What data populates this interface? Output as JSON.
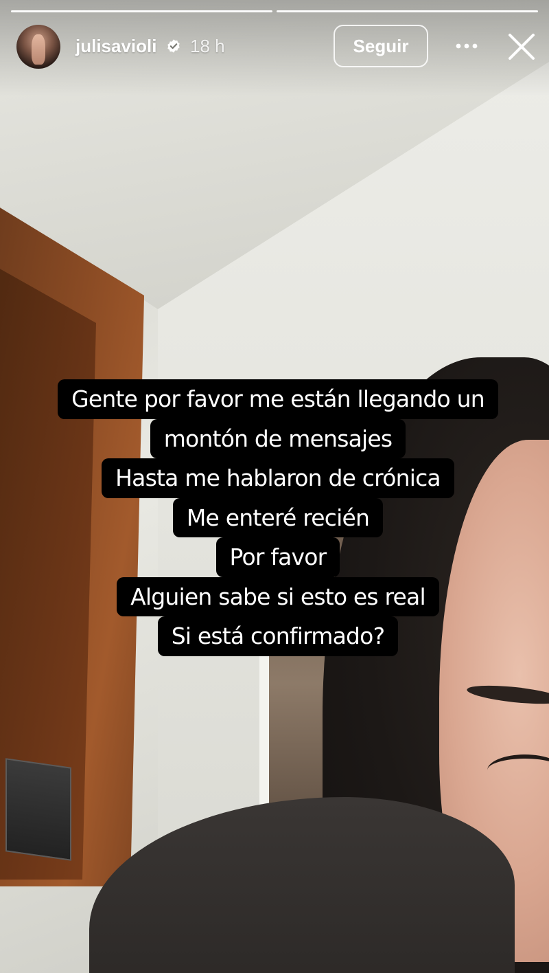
{
  "story": {
    "progress": {
      "segments": 2,
      "current": 2
    },
    "header": {
      "username": "julisavioli",
      "verified": true,
      "time": "18 h",
      "follow_label": "Seguir"
    },
    "caption_lines": [
      "Gente por favor me están llegando un",
      "montón de mensajes",
      "Hasta me hablaron de crónica",
      "Me enteré recién",
      "Por favor",
      "Alguien sabe si esto es real",
      "Si está confirmado?"
    ],
    "icons": {
      "verified": "verified-badge-icon",
      "more": "more-horizontal-icon",
      "close": "close-icon"
    },
    "colors": {
      "caption_bg": "#000000",
      "text": "#ffffff",
      "verified_badge": "#ffffff"
    }
  }
}
